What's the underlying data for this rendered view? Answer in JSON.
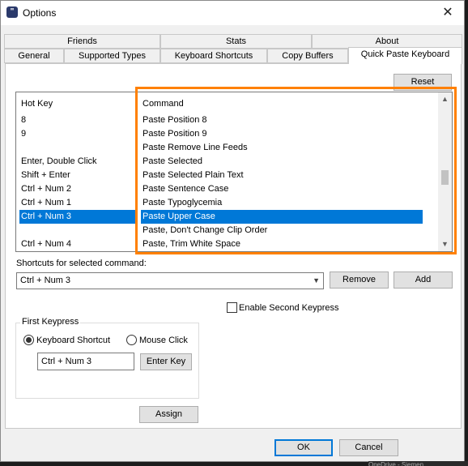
{
  "window": {
    "title": "Options",
    "close": "✕"
  },
  "tabs_row1": [
    "Friends",
    "Stats",
    "About"
  ],
  "tabs_row2": [
    "General",
    "Supported Types",
    "Keyboard Shortcuts",
    "Copy Buffers",
    "Quick Paste Keyboard"
  ],
  "reset_label": "Reset",
  "list": {
    "hotkey_header": "Hot Key",
    "command_header": "Command",
    "hotkeys": [
      "8",
      "9",
      "",
      "Enter, Double Click",
      "Shift + Enter",
      "Ctrl + Num 2",
      "Ctrl + Num 1",
      "Ctrl + Num 3",
      "",
      "Ctrl + Num 4"
    ],
    "commands": [
      "Paste Position 8",
      "Paste Position 9",
      "Paste Remove Line Feeds",
      "Paste Selected",
      "Paste Selected Plain Text",
      "Paste Sentence Case",
      "Paste Typoglycemia",
      "Paste Upper Case",
      "Paste, Don't Change Clip Order",
      "Paste, Trim White Space"
    ],
    "selected_index": 7
  },
  "shortcuts": {
    "label": "Shortcuts for selected command:",
    "value": "Ctrl + Num 3",
    "remove_label": "Remove",
    "add_label": "Add"
  },
  "enable_second_keypress": {
    "label": "Enable Second Keypress",
    "checked": false
  },
  "first_keypress": {
    "title": "First Keypress",
    "keyboard_shortcut_label": "Keyboard Shortcut",
    "mouse_click_label": "Mouse Click",
    "selected": "Keyboard Shortcut",
    "key_value": "Ctrl + Num 3",
    "enter_key_label": "Enter Key"
  },
  "assign_label": "Assign",
  "ok_label": "OK",
  "cancel_label": "Cancel",
  "taskbar_fragment": "OneDrive - Siemen"
}
